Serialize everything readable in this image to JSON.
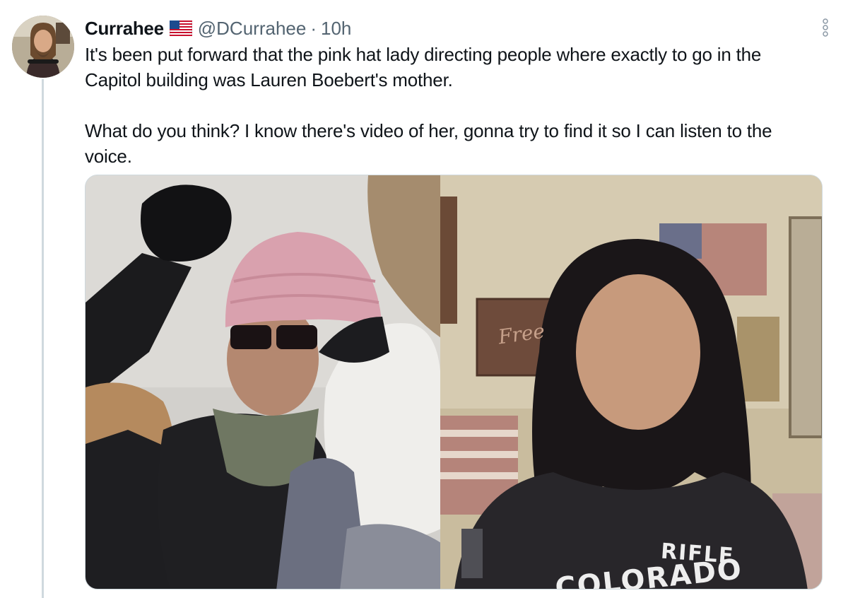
{
  "tweet": {
    "author": {
      "display_name": "Currahee",
      "handle": "@DCurrahee",
      "badge_icon": "us-flag-icon",
      "avatar_icon": "bearded-man-avatar"
    },
    "separator": "·",
    "time": "10h",
    "text_paragraphs": [
      "It's been put forward that the pink hat lady directing people where exactly to go in the Capitol building was Lauren Boebert's mother.",
      "What do you think? I know there's video of her, gonna try to find it so I can listen to the voice."
    ],
    "more_icon": "more-vertical-icon",
    "media": {
      "photos": [
        {
          "description_icon": "photo-woman-pink-hat"
        },
        {
          "description_icon": "photo-woman-dark-hair",
          "shirt_text_line1": "RIFLE",
          "shirt_text_line2": "COLORADO",
          "wall_sign_text": "Free"
        }
      ]
    }
  },
  "colors": {
    "text_primary": "#0f1419",
    "text_secondary": "#536471",
    "thread_line": "#cfd9de",
    "border": "#cfd9de"
  }
}
